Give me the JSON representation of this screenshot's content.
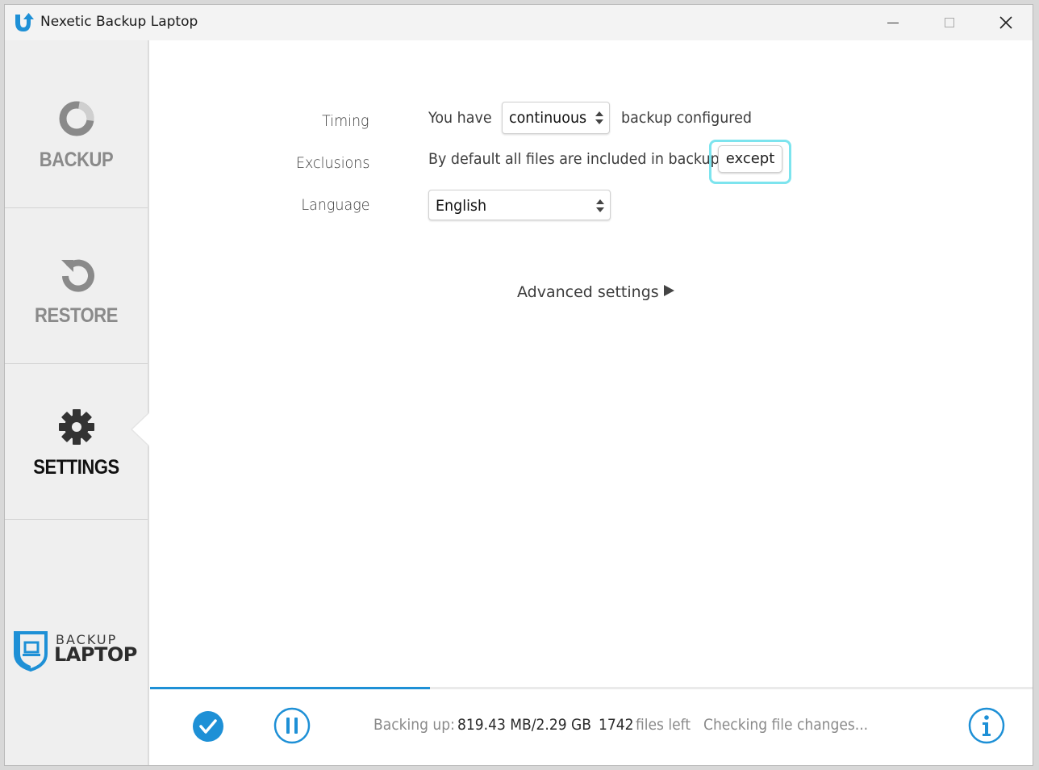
{
  "window": {
    "title": "Nexetic Backup Laptop",
    "accent_color": "#1e90d6"
  },
  "sidebar": {
    "items": [
      {
        "label": "BACKUP",
        "icon": "backup-ring-icon",
        "active": false
      },
      {
        "label": "RESTORE",
        "icon": "restore-arrow-icon",
        "active": false
      },
      {
        "label": "SETTINGS",
        "icon": "gear-icon",
        "active": true
      }
    ],
    "brand": {
      "top": "BACKUP",
      "bottom": "LAPTOP"
    }
  },
  "settings": {
    "timing": {
      "label": "Timing",
      "prefix": "You have",
      "value": "continuous",
      "suffix": "backup configured"
    },
    "exclusions": {
      "label": "Exclusions",
      "text": "By default all files are included in backup",
      "button": "except"
    },
    "language": {
      "label": "Language",
      "value": "English"
    },
    "advanced": "Advanced settings"
  },
  "status": {
    "progress_fraction": 0.317,
    "backing_up_label": "Backing up:",
    "size": "819.43 MB/2.29 GB",
    "files_count": "1742",
    "files_label": "files left",
    "state": "Checking file changes..."
  }
}
